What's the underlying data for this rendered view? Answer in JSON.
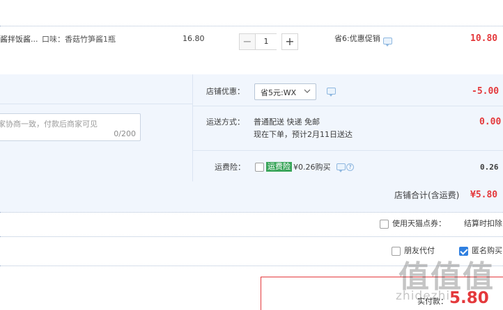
{
  "item": {
    "name": "酱拌饭酱...",
    "spec": "口味：香菇竹笋酱1瓶",
    "unit_price": "16.80",
    "quantity": "1",
    "minus": "−",
    "plus": "+",
    "promo": "省6:优惠促销",
    "subtotal": "10.80"
  },
  "shop": {
    "discount_label": "店铺优惠：",
    "discount_select": "省5元:WX",
    "discount_value": "-5.00",
    "memo_placeholder": "家协商一致，付款后商家可见",
    "memo_count": "0/200",
    "shipping_label": "运送方式：",
    "shipping_method": "普通配送 快递 免邮",
    "shipping_eta": "现在下单，预计2月11日送达",
    "shipping_fee": "0.00",
    "insurance_label": "运费险：",
    "insurance_tag": "运费险",
    "insurance_price": "¥0.26购买",
    "insurance_value": "0.26",
    "total_label": "店铺合计(含运费)",
    "total_value": "¥5.80"
  },
  "options": {
    "tmall_points": "使用天猫点券：",
    "tmall_points_note": "结算时扣除",
    "friend_pay": "朋友代付",
    "anonymous": "匿名购买"
  },
  "pay": {
    "label": "实付款：",
    "amount": "5.80"
  },
  "watermark": {
    "main": "值值值",
    "sub": "zhidezhi"
  },
  "colors": {
    "accent_red": "#e4393c",
    "panel_blue": "#f1f6fd",
    "checkbox_blue": "#2f7fe0",
    "tag_green": "#3aa55a"
  }
}
